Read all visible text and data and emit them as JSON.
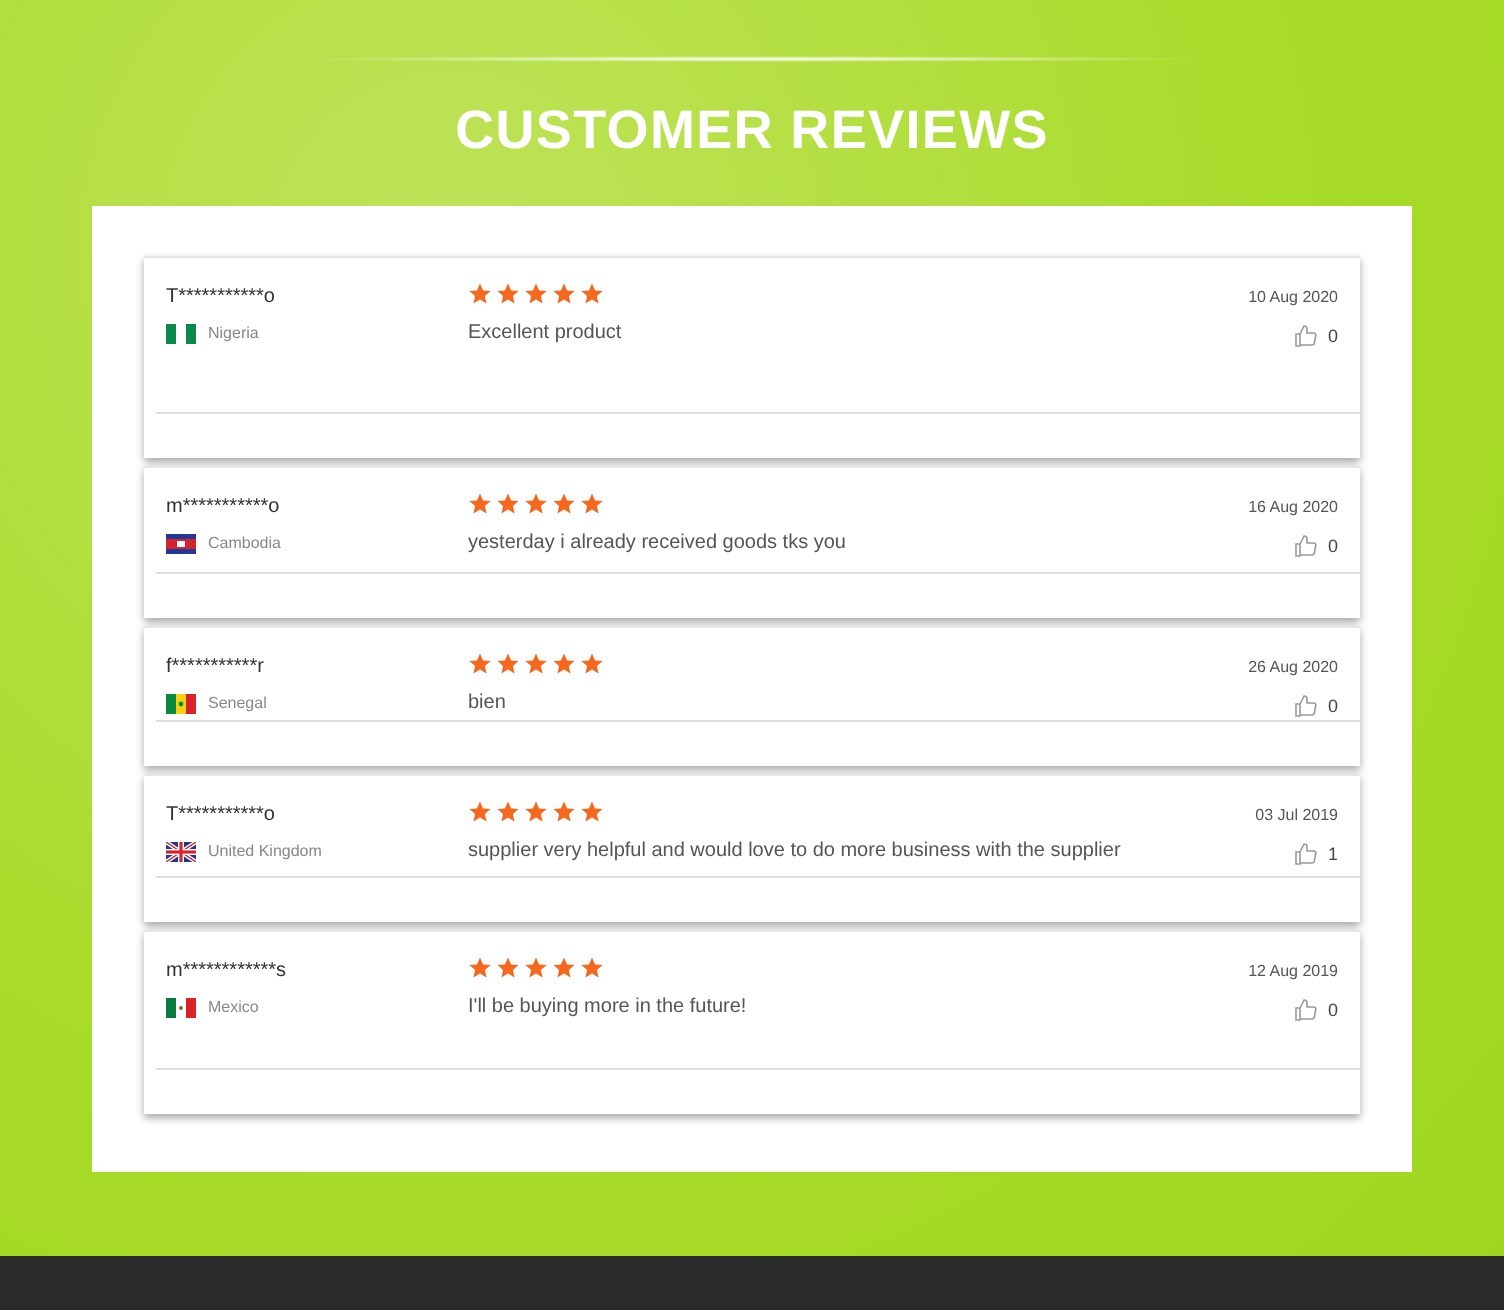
{
  "title": "CUSTOMER REVIEWS",
  "reviews": [
    {
      "name": "T***********o",
      "country": "Nigeria",
      "stars": 5,
      "text": "Excellent product",
      "date": "10 Aug 2020",
      "likes": "0"
    },
    {
      "name": "m***********o",
      "country": "Cambodia",
      "stars": 5,
      "text": "yesterday i already received goods tks you",
      "date": "16 Aug 2020",
      "likes": "0"
    },
    {
      "name": "f***********r",
      "country": "Senegal",
      "stars": 5,
      "text": "bien",
      "date": "26 Aug 2020",
      "likes": "0"
    },
    {
      "name": "T***********o",
      "country": "United Kingdom",
      "stars": 5,
      "text": "supplier very helpful and would love to do more business with the supplier",
      "date": "03 Jul 2019",
      "likes": "1"
    },
    {
      "name": "m************s",
      "country": "Mexico",
      "stars": 5,
      "text": "I'll be buying more in the future!",
      "date": "12 Aug 2019",
      "likes": "0"
    }
  ]
}
